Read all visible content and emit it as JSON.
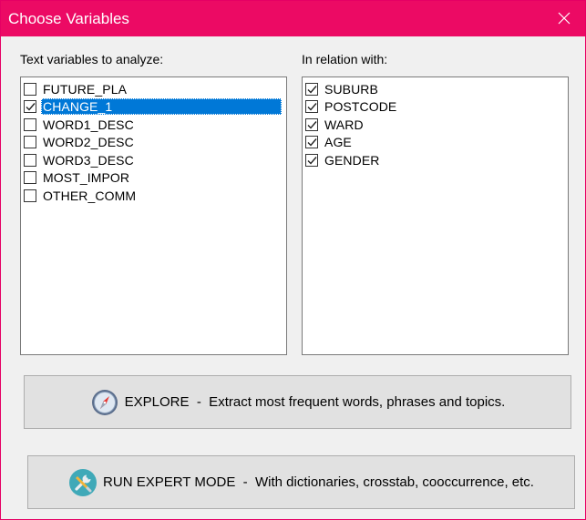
{
  "window": {
    "title": "Choose Variables"
  },
  "left_panel": {
    "label": "Text variables to analyze:",
    "items": [
      {
        "label": "FUTURE_PLA",
        "checked": false
      },
      {
        "label": "CHANGE_1",
        "checked": true,
        "selected": true
      },
      {
        "label": "WORD1_DESC",
        "checked": false
      },
      {
        "label": "WORD2_DESC",
        "checked": false
      },
      {
        "label": "WORD3_DESC",
        "checked": false
      },
      {
        "label": "MOST_IMPOR",
        "checked": false
      },
      {
        "label": "OTHER_COMM",
        "checked": false
      }
    ]
  },
  "right_panel": {
    "label": "In relation with:",
    "items": [
      {
        "label": "SUBURB",
        "checked": true
      },
      {
        "label": "POSTCODE",
        "checked": true
      },
      {
        "label": "WARD",
        "checked": true
      },
      {
        "label": "AGE",
        "checked": true
      },
      {
        "label": "GENDER",
        "checked": true
      }
    ]
  },
  "buttons": {
    "explore": {
      "label": "EXPLORE  -  Extract most frequent words, phrases and topics.",
      "icon": "compass-icon"
    },
    "expert": {
      "label": "RUN EXPERT MODE  -  With dictionaries, crosstab, cooccurrence, etc.",
      "icon": "tools-icon"
    }
  },
  "colors": {
    "titlebar": "#ec0a64",
    "selection": "#0078d7"
  }
}
